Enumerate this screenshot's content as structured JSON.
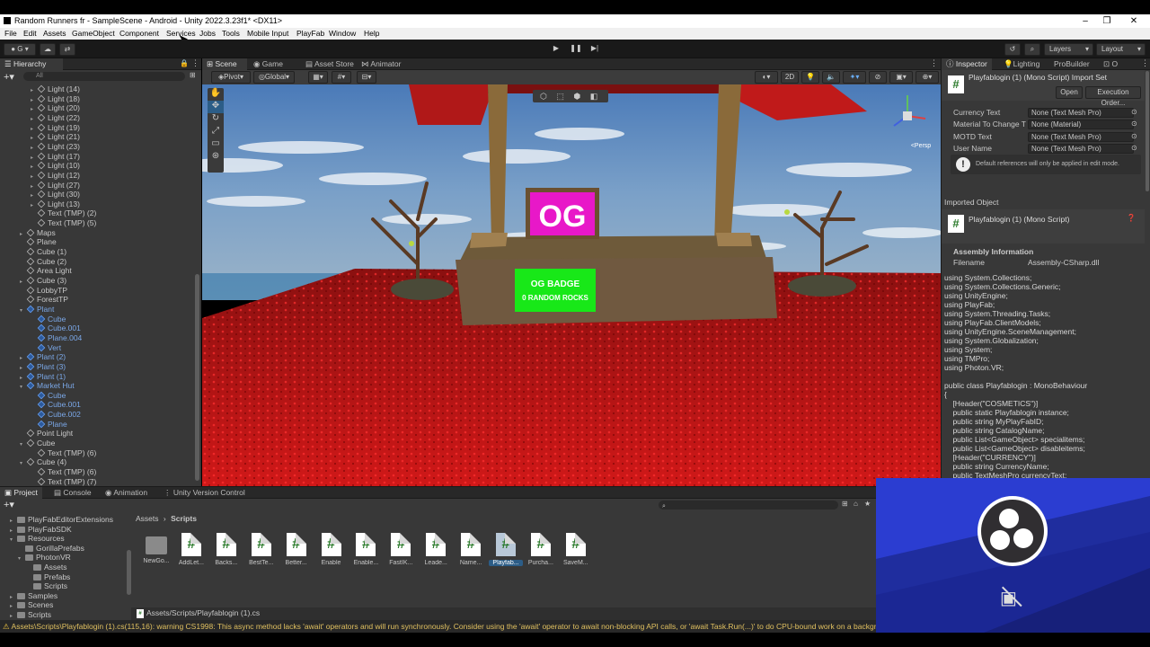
{
  "window": {
    "title": "Random Runners fr - SampleScene - Android - Unity 2022.3.23f1* <DX11>"
  },
  "menu": [
    "File",
    "Edit",
    "Assets",
    "GameObject",
    "Component",
    "Services",
    "Jobs",
    "Tools",
    "Mobile Input",
    "PlayFab",
    "Window",
    "Help"
  ],
  "toolbar": {
    "account": "G",
    "layers": "Layers",
    "layout": "Layout"
  },
  "hierarchy": {
    "tab": "Hierarchy",
    "search_placeholder": "All",
    "items": [
      {
        "label": "Light (14)",
        "indent": 2,
        "prefab": false,
        "arrow": "▸"
      },
      {
        "label": "Light (18)",
        "indent": 2,
        "prefab": false,
        "arrow": "▸"
      },
      {
        "label": "Light (20)",
        "indent": 2,
        "prefab": false,
        "arrow": "▸"
      },
      {
        "label": "Light (22)",
        "indent": 2,
        "prefab": false,
        "arrow": "▸"
      },
      {
        "label": "Light (19)",
        "indent": 2,
        "prefab": false,
        "arrow": "▸"
      },
      {
        "label": "Light (21)",
        "indent": 2,
        "prefab": false,
        "arrow": "▸"
      },
      {
        "label": "Light (23)",
        "indent": 2,
        "prefab": false,
        "arrow": "▸"
      },
      {
        "label": "Light (17)",
        "indent": 2,
        "prefab": false,
        "arrow": "▸"
      },
      {
        "label": "Light (10)",
        "indent": 2,
        "prefab": false,
        "arrow": "▸"
      },
      {
        "label": "Light (12)",
        "indent": 2,
        "prefab": false,
        "arrow": "▸"
      },
      {
        "label": "Light (27)",
        "indent": 2,
        "prefab": false,
        "arrow": "▸"
      },
      {
        "label": "Light (30)",
        "indent": 2,
        "prefab": false,
        "arrow": "▸"
      },
      {
        "label": "Light (13)",
        "indent": 2,
        "prefab": false,
        "arrow": "▸"
      },
      {
        "label": "Text (TMP) (2)",
        "indent": 2,
        "prefab": false,
        "arrow": ""
      },
      {
        "label": "Text (TMP) (5)",
        "indent": 2,
        "prefab": false,
        "arrow": ""
      },
      {
        "label": "Maps",
        "indent": 1,
        "prefab": false,
        "arrow": "▸"
      },
      {
        "label": "Plane",
        "indent": 1,
        "prefab": false,
        "arrow": ""
      },
      {
        "label": "Cube (1)",
        "indent": 1,
        "prefab": false,
        "arrow": ""
      },
      {
        "label": "Cube (2)",
        "indent": 1,
        "prefab": false,
        "arrow": ""
      },
      {
        "label": "Area Light",
        "indent": 1,
        "prefab": false,
        "arrow": ""
      },
      {
        "label": "Cube (3)",
        "indent": 1,
        "prefab": false,
        "arrow": "▸"
      },
      {
        "label": "LobbyTP",
        "indent": 1,
        "prefab": false,
        "arrow": ""
      },
      {
        "label": "ForestTP",
        "indent": 1,
        "prefab": false,
        "arrow": ""
      },
      {
        "label": "Plant",
        "indent": 1,
        "prefab": true,
        "arrow": "▾"
      },
      {
        "label": "Cube",
        "indent": 2,
        "prefab": true,
        "arrow": ""
      },
      {
        "label": "Cube.001",
        "indent": 2,
        "prefab": true,
        "arrow": ""
      },
      {
        "label": "Plane.004",
        "indent": 2,
        "prefab": true,
        "arrow": ""
      },
      {
        "label": "Vert",
        "indent": 2,
        "prefab": true,
        "arrow": ""
      },
      {
        "label": "Plant (2)",
        "indent": 1,
        "prefab": true,
        "arrow": "▸"
      },
      {
        "label": "Plant (3)",
        "indent": 1,
        "prefab": true,
        "arrow": "▸"
      },
      {
        "label": "Plant (1)",
        "indent": 1,
        "prefab": true,
        "arrow": "▸"
      },
      {
        "label": "Market Hut",
        "indent": 1,
        "prefab": true,
        "arrow": "▾"
      },
      {
        "label": "Cube",
        "indent": 2,
        "prefab": true,
        "arrow": ""
      },
      {
        "label": "Cube.001",
        "indent": 2,
        "prefab": true,
        "arrow": ""
      },
      {
        "label": "Cube.002",
        "indent": 2,
        "prefab": true,
        "arrow": ""
      },
      {
        "label": "Plane",
        "indent": 2,
        "prefab": true,
        "arrow": ""
      },
      {
        "label": "Point Light",
        "indent": 1,
        "prefab": false,
        "arrow": ""
      },
      {
        "label": "Cube",
        "indent": 1,
        "prefab": false,
        "arrow": "▾"
      },
      {
        "label": "Text (TMP) (6)",
        "indent": 2,
        "prefab": false,
        "arrow": ""
      },
      {
        "label": "Cube (4)",
        "indent": 1,
        "prefab": false,
        "arrow": "▾"
      },
      {
        "label": "Text (TMP) (6)",
        "indent": 2,
        "prefab": false,
        "arrow": ""
      },
      {
        "label": "Text (TMP) (7)",
        "indent": 2,
        "prefab": false,
        "arrow": ""
      }
    ]
  },
  "scene": {
    "tabs": [
      "Scene",
      "Game",
      "Asset Store",
      "Animator"
    ],
    "pivot": "Pivot",
    "global": "Global",
    "mode_2d": "2D",
    "gizmo_label": "<Persp",
    "sign_text": "OG",
    "badge_line1": "OG BADGE",
    "badge_line2": "0 RANDOM ROCKS"
  },
  "inspector": {
    "tabs": [
      "Inspector",
      "Lighting",
      "ProBuilder",
      "O"
    ],
    "header_title": "Playfablogin (1) (Mono Script) Import Set",
    "open_button": "Open",
    "execution_order_button": "Execution Order...",
    "fields": [
      {
        "label": "Currency Text",
        "value": "None (Text Mesh Pro)"
      },
      {
        "label": "Material To Change T",
        "value": "None (Material)"
      },
      {
        "label": "MOTD Text",
        "value": "None (Text Mesh Pro)"
      },
      {
        "label": "User Name",
        "value": "None (Text Mesh Pro)"
      }
    ],
    "info_message": "Default references will only be applied in edit mode.",
    "imported_object_header": "Imported Object",
    "imported_object_title": "Playfablogin (1) (Mono Script)",
    "assembly_header": "Assembly Information",
    "filename_label": "Filename",
    "filename_value": "Assembly-CSharp.dll",
    "code_lines": [
      "using System.Collections;",
      "using System.Collections.Generic;",
      "using UnityEngine;",
      "using PlayFab;",
      "using System.Threading.Tasks;",
      "using PlayFab.ClientModels;",
      "using UnityEngine.SceneManagement;",
      "using System.Globalization;",
      "using System;",
      "using TMPro;",
      "using Photon.VR;",
      "",
      "public class Playfablogin : MonoBehaviour",
      "{",
      "    [Header(\"COSMETICS\")]",
      "    public static Playfablogin instance;",
      "    public string MyPlayFabID;",
      "    public string CatalogName;",
      "    public List<GameObject> specialitems;",
      "    public List<GameObject> disableitems;",
      "    [Header(\"CURRENCY\")]",
      "    public string CurrencyName;",
      "    public TextMeshPro currencyText;"
    ]
  },
  "project": {
    "tabs": [
      "Project",
      "Console",
      "Animation",
      "Unity Version Control"
    ],
    "tree": [
      {
        "label": "PlayFabEditorExtensions",
        "indent": 1,
        "arrow": "▸"
      },
      {
        "label": "PlayFabSDK",
        "indent": 1,
        "arrow": "▸"
      },
      {
        "label": "Resources",
        "indent": 1,
        "arrow": "▾"
      },
      {
        "label": "GorillaPrefabs",
        "indent": 2,
        "arrow": ""
      },
      {
        "label": "PhotonVR",
        "indent": 2,
        "arrow": "▾"
      },
      {
        "label": "Assets",
        "indent": 3,
        "arrow": ""
      },
      {
        "label": "Prefabs",
        "indent": 3,
        "arrow": ""
      },
      {
        "label": "Scripts",
        "indent": 3,
        "arrow": ""
      },
      {
        "label": "Samples",
        "indent": 1,
        "arrow": "▸"
      },
      {
        "label": "Scenes",
        "indent": 1,
        "arrow": "▸"
      },
      {
        "label": "Scripts",
        "indent": 1,
        "arrow": "▸"
      }
    ],
    "breadcrumb_root": "Assets",
    "breadcrumb_sep": "›",
    "breadcrumb_current": "Scripts",
    "assets": [
      {
        "label": "NewGo...",
        "kind": "folder"
      },
      {
        "label": "AddLet...",
        "kind": "script"
      },
      {
        "label": "Backs...",
        "kind": "script"
      },
      {
        "label": "BestTe...",
        "kind": "script"
      },
      {
        "label": "Better...",
        "kind": "script"
      },
      {
        "label": "Enable",
        "kind": "script"
      },
      {
        "label": "Enable...",
        "kind": "script"
      },
      {
        "label": "FastIK...",
        "kind": "script"
      },
      {
        "label": "Leade...",
        "kind": "script"
      },
      {
        "label": "Name...",
        "kind": "script"
      },
      {
        "label": "Playfab...",
        "kind": "script",
        "selected": true
      },
      {
        "label": "Purcha...",
        "kind": "script"
      },
      {
        "label": "SaveM...",
        "kind": "script"
      }
    ],
    "selected_path": "Assets/Scripts/Playfablogin (1).cs"
  },
  "status": {
    "message": "Assets\\Scripts\\Playfablogin (1).cs(115,16): warning CS1998: This async method lacks 'await' operators and will run synchronously. Consider using the 'await' operator to await non-blocking API calls, or 'await Task.Run(...)' to do CPU-bound work on a backgrou"
  },
  "colors": {
    "accent_selection": "#2c5d87",
    "prefab_blue": "#7ba8e8",
    "warning_yellow": "#e0c060",
    "obs_blue": "#2b3dd1"
  }
}
